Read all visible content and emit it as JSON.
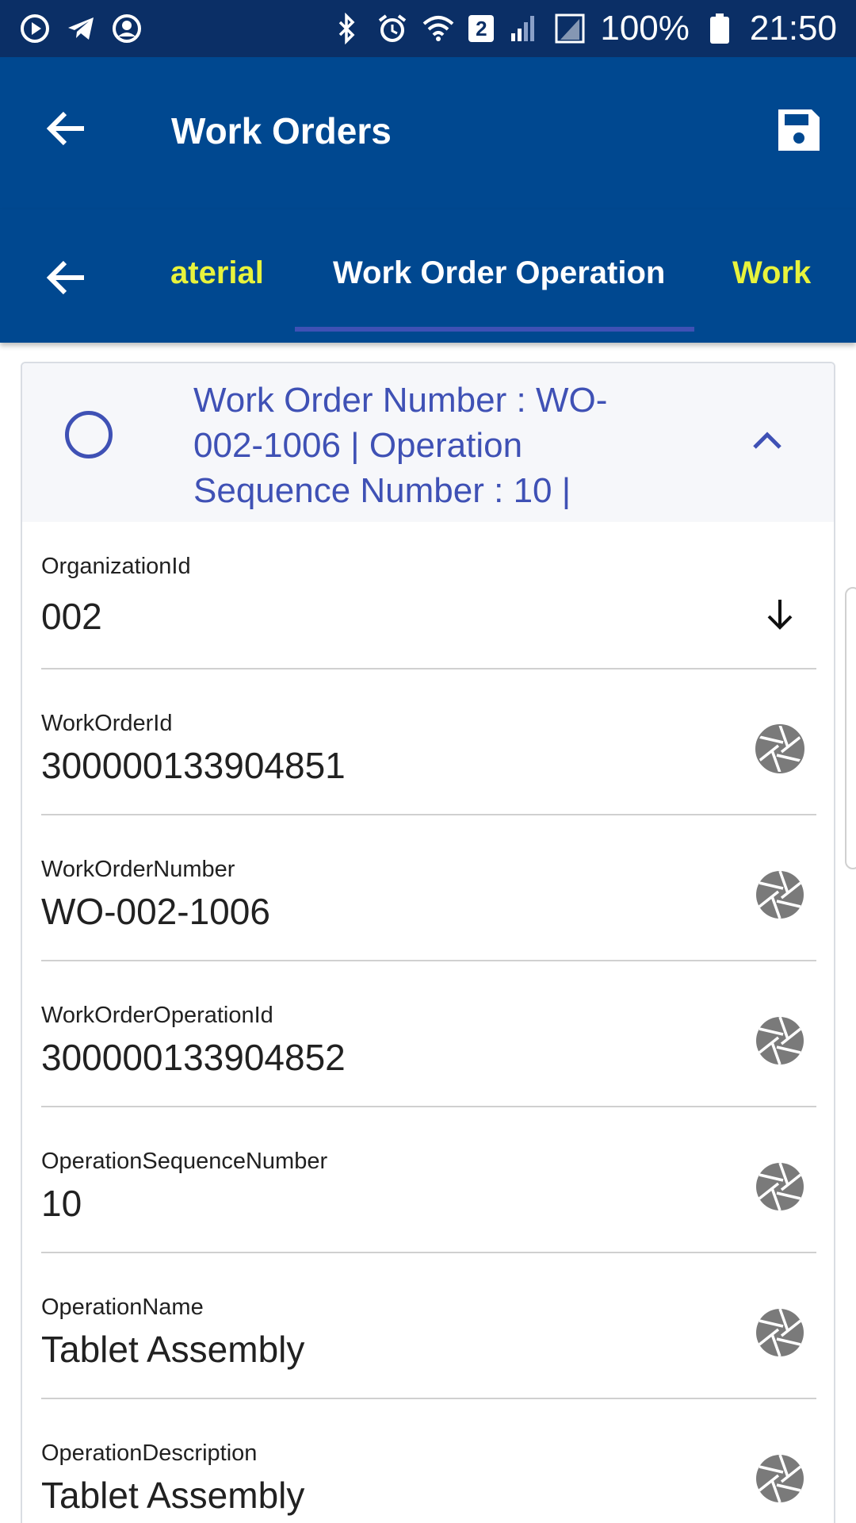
{
  "status_bar": {
    "battery_text": "100%",
    "time": "21:50",
    "sim_badge": "2",
    "icons": [
      "play-circle-icon",
      "telegram-icon",
      "account-circle-icon",
      "bluetooth-icon",
      "alarm-icon",
      "wifi-icon",
      "signal-icon",
      "signal-roaming-icon",
      "battery-icon"
    ]
  },
  "app_bar": {
    "title": "Work Orders",
    "back_icon": "arrow-left-icon",
    "save_icon": "floppy-disk-icon"
  },
  "tabs": {
    "back_icon": "arrow-left-icon",
    "items": [
      {
        "label": "aterial",
        "state": "partial"
      },
      {
        "label": "Work Order Operation",
        "state": "active"
      },
      {
        "label": "Work",
        "state": "partial"
      }
    ]
  },
  "card": {
    "title": "Work Order Number : WO-002-1006 | Operation Sequence Number : 10 |",
    "fields": [
      {
        "label": "OrganizationId",
        "value": "002",
        "icon": "arrow-down-icon"
      },
      {
        "label": "WorkOrderId",
        "value": "300000133904851",
        "icon": "camera-aperture-icon"
      },
      {
        "label": "WorkOrderNumber",
        "value": "WO-002-1006",
        "icon": "camera-aperture-icon"
      },
      {
        "label": "WorkOrderOperationId",
        "value": "300000133904852",
        "icon": "camera-aperture-icon"
      },
      {
        "label": "OperationSequenceNumber",
        "value": "10",
        "icon": "camera-aperture-icon"
      },
      {
        "label": "OperationName",
        "value": "Tablet Assembly",
        "icon": "camera-aperture-icon"
      },
      {
        "label": "OperationDescription",
        "value": "Tablet Assembly",
        "icon": "camera-aperture-icon"
      }
    ]
  },
  "colors": {
    "status_bar": "#0b2f66",
    "app_bar": "#004890",
    "accent": "#3f51b5",
    "tab_inactive": "#e8f33c"
  }
}
